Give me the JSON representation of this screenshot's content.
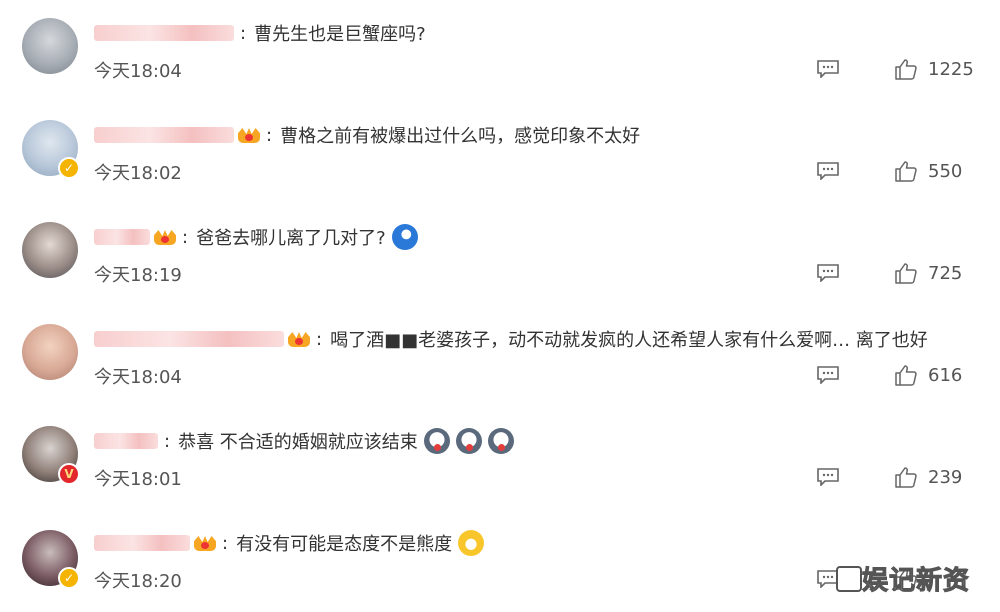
{
  "comments": [
    {
      "text": "曹先生也是巨蟹座吗?",
      "time": "今天18:04",
      "likes": "1225",
      "emojis": [],
      "badge": "",
      "crown": false,
      "name_width": 140
    },
    {
      "text": "曹格之前有被爆出过什么吗，感觉印象不太好",
      "time": "今天18:02",
      "likes": "550",
      "emojis": [],
      "badge": "gold",
      "crown": true,
      "name_width": 140
    },
    {
      "text": "爸爸去哪儿离了几对了?",
      "time": "今天18:19",
      "likes": "725",
      "emojis": [
        "blue"
      ],
      "badge": "",
      "crown": true,
      "name_width": 56
    },
    {
      "text": "喝了酒■■老婆孩子，动不动就发疯的人还希望人家有什么爱啊… 离了也好",
      "time": "今天18:04",
      "likes": "616",
      "emojis": [],
      "badge": "",
      "crown": true,
      "name_width": 190
    },
    {
      "text": "恭喜 不合适的婚姻就应该结束",
      "time": "今天18:01",
      "likes": "239",
      "emojis": [
        "dog",
        "dog",
        "dog"
      ],
      "badge": "red",
      "crown": false,
      "name_width": 64
    },
    {
      "text": "有没有可能是态度不是熊度",
      "time": "今天18:20",
      "likes": "",
      "emojis": [
        "laugh"
      ],
      "badge": "gold",
      "crown": true,
      "name_width": 96
    }
  ],
  "separator": ":",
  "watermark": "娱记新资",
  "icons": {
    "reply": "comment-icon",
    "like": "thumbs-up-icon",
    "vip": "crown-icon"
  }
}
